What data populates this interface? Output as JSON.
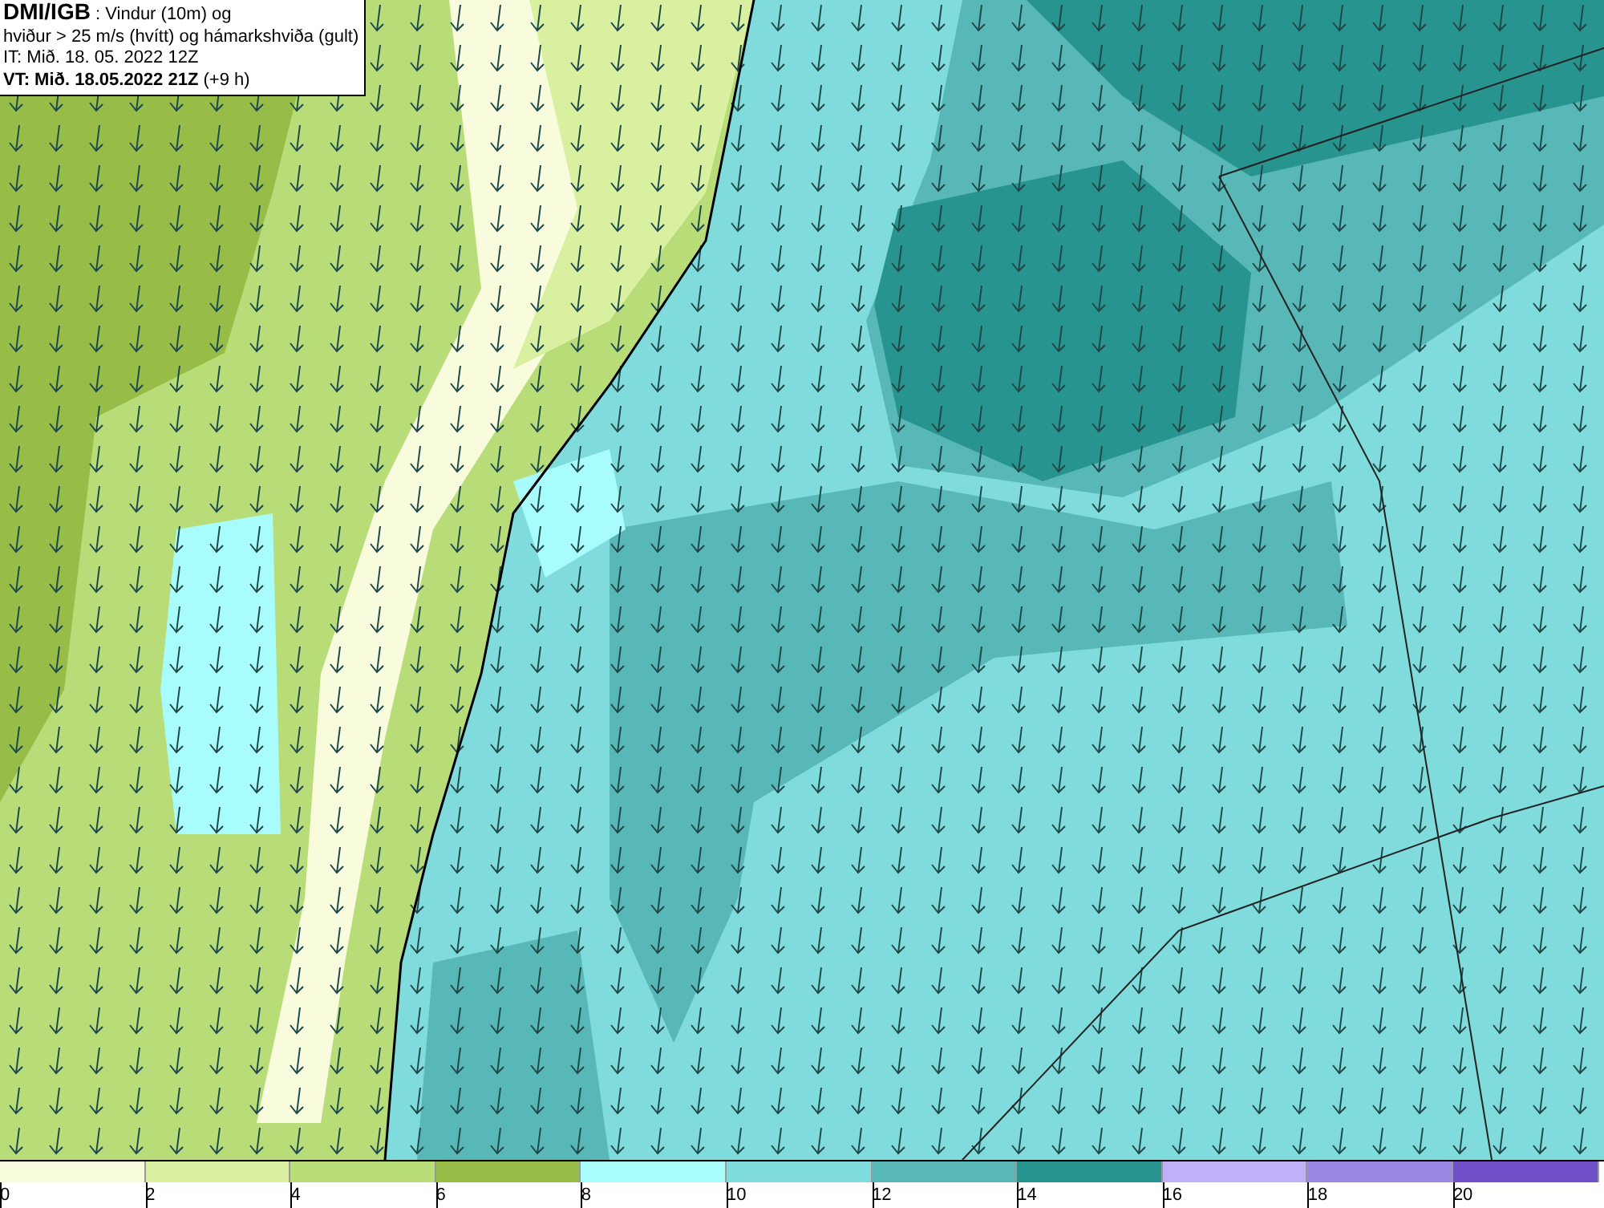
{
  "header": {
    "lines": [
      "**DMI/IGB** : Vindur (10m) og",
      "hviður > 25 m/s (hvítt) og hámarkshviða (gult)",
      "IT: Mið. 18. 05. 2022 12Z",
      "**VT: Mið. 18.05.2022 21Z** (+9 h)"
    ]
  },
  "legend": {
    "bins": [
      {
        "color": "#f8fcdc"
      },
      {
        "color": "#d8f0a0"
      },
      {
        "color": "#b8dc78"
      },
      {
        "color": "#98bc48"
      },
      {
        "color": "#a8fcfc"
      },
      {
        "color": "#80dcdc"
      },
      {
        "color": "#58b8b8"
      },
      {
        "color": "#28948f"
      },
      {
        "color": "#c0b0f8"
      },
      {
        "color": "#9c88e4"
      },
      {
        "color": "#7050c8"
      }
    ],
    "labels": [
      "0",
      "2",
      "4",
      "6",
      "8",
      "10",
      "12",
      "14",
      "16",
      "18",
      "20"
    ]
  }
}
